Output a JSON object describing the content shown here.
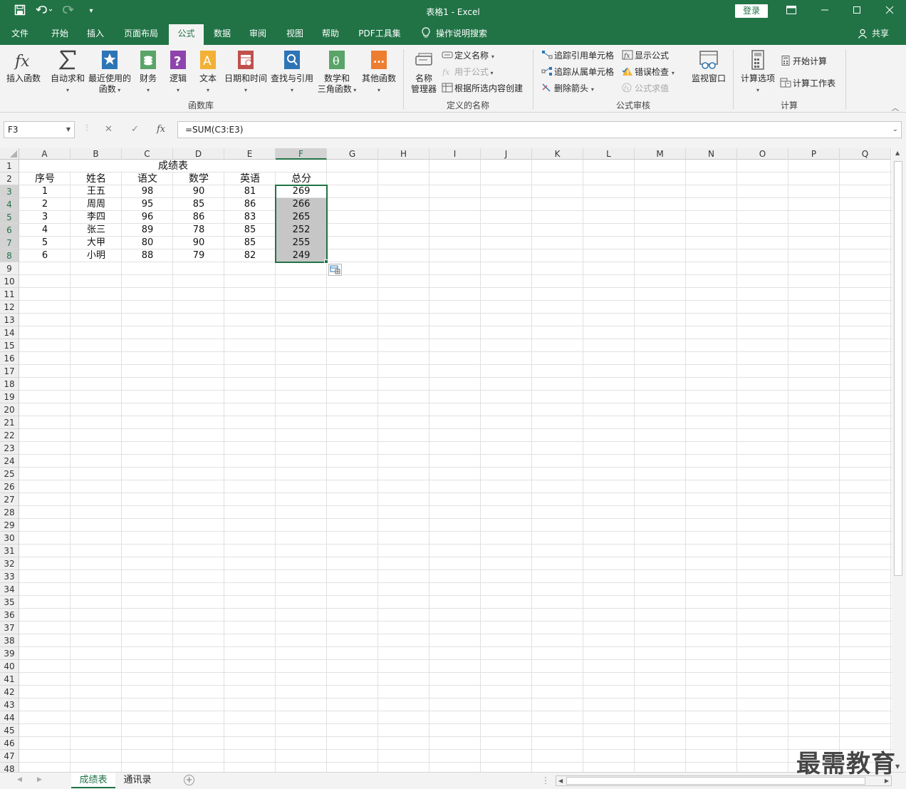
{
  "window": {
    "title": "表格1  -  Excel",
    "login_label": "登录",
    "share_label": "共享"
  },
  "menu": {
    "tabs": [
      "文件",
      "开始",
      "插入",
      "页面布局",
      "公式",
      "数据",
      "审阅",
      "视图",
      "帮助",
      "PDF工具集"
    ],
    "active_tab": "公式",
    "tell_me": "操作说明搜索"
  },
  "ribbon": {
    "function_library": {
      "label": "函数库",
      "insert_function": "插入函数",
      "autosum": "自动求和",
      "recently_used_1": "最近使用的",
      "recently_used_2": "函数",
      "financial": "财务",
      "logical": "逻辑",
      "text": "文本",
      "date_time": "日期和时间",
      "lookup": "查找与引用",
      "math_1": "数学和",
      "math_2": "三角函数",
      "more": "其他函数"
    },
    "defined_names": {
      "label": "定义的名称",
      "name_manager_1": "名称",
      "name_manager_2": "管理器",
      "define_name": "定义名称",
      "use_in_formula": "用于公式",
      "create_from_selection": "根据所选内容创建"
    },
    "formula_auditing": {
      "label": "公式审核",
      "trace_precedents": "追踪引用单元格",
      "trace_dependents": "追踪从属单元格",
      "remove_arrows": "删除箭头",
      "show_formulas": "显示公式",
      "error_checking": "错误检查",
      "evaluate_formula": "公式求值",
      "watch_window": "监视窗口"
    },
    "calculation": {
      "label": "计算",
      "calc_options": "计算选项",
      "calc_now": "开始计算",
      "calc_sheet": "计算工作表"
    }
  },
  "formula_bar": {
    "name_box": "F3",
    "fx": "fx",
    "formula": "=SUM(C3:E3)"
  },
  "columns": [
    "A",
    "B",
    "C",
    "D",
    "E",
    "F",
    "G",
    "H",
    "I",
    "J",
    "K",
    "L",
    "M",
    "N",
    "O",
    "P",
    "Q"
  ],
  "selected_column": "F",
  "sheet": {
    "title": "成绩表",
    "headers": [
      "序号",
      "姓名",
      "语文",
      "数学",
      "英语",
      "总分"
    ],
    "rows": [
      [
        "1",
        "王五",
        "98",
        "90",
        "81",
        "269"
      ],
      [
        "2",
        "周周",
        "95",
        "85",
        "86",
        "266"
      ],
      [
        "3",
        "李四",
        "96",
        "86",
        "83",
        "265"
      ],
      [
        "4",
        "张三",
        "89",
        "78",
        "85",
        "252"
      ],
      [
        "5",
        "大甲",
        "80",
        "90",
        "85",
        "255"
      ],
      [
        "6",
        "小明",
        "88",
        "79",
        "82",
        "249"
      ]
    ]
  },
  "sheet_tabs": [
    "成绩表",
    "通讯录"
  ],
  "active_sheet": "成绩表",
  "watermark": "最需教育"
}
